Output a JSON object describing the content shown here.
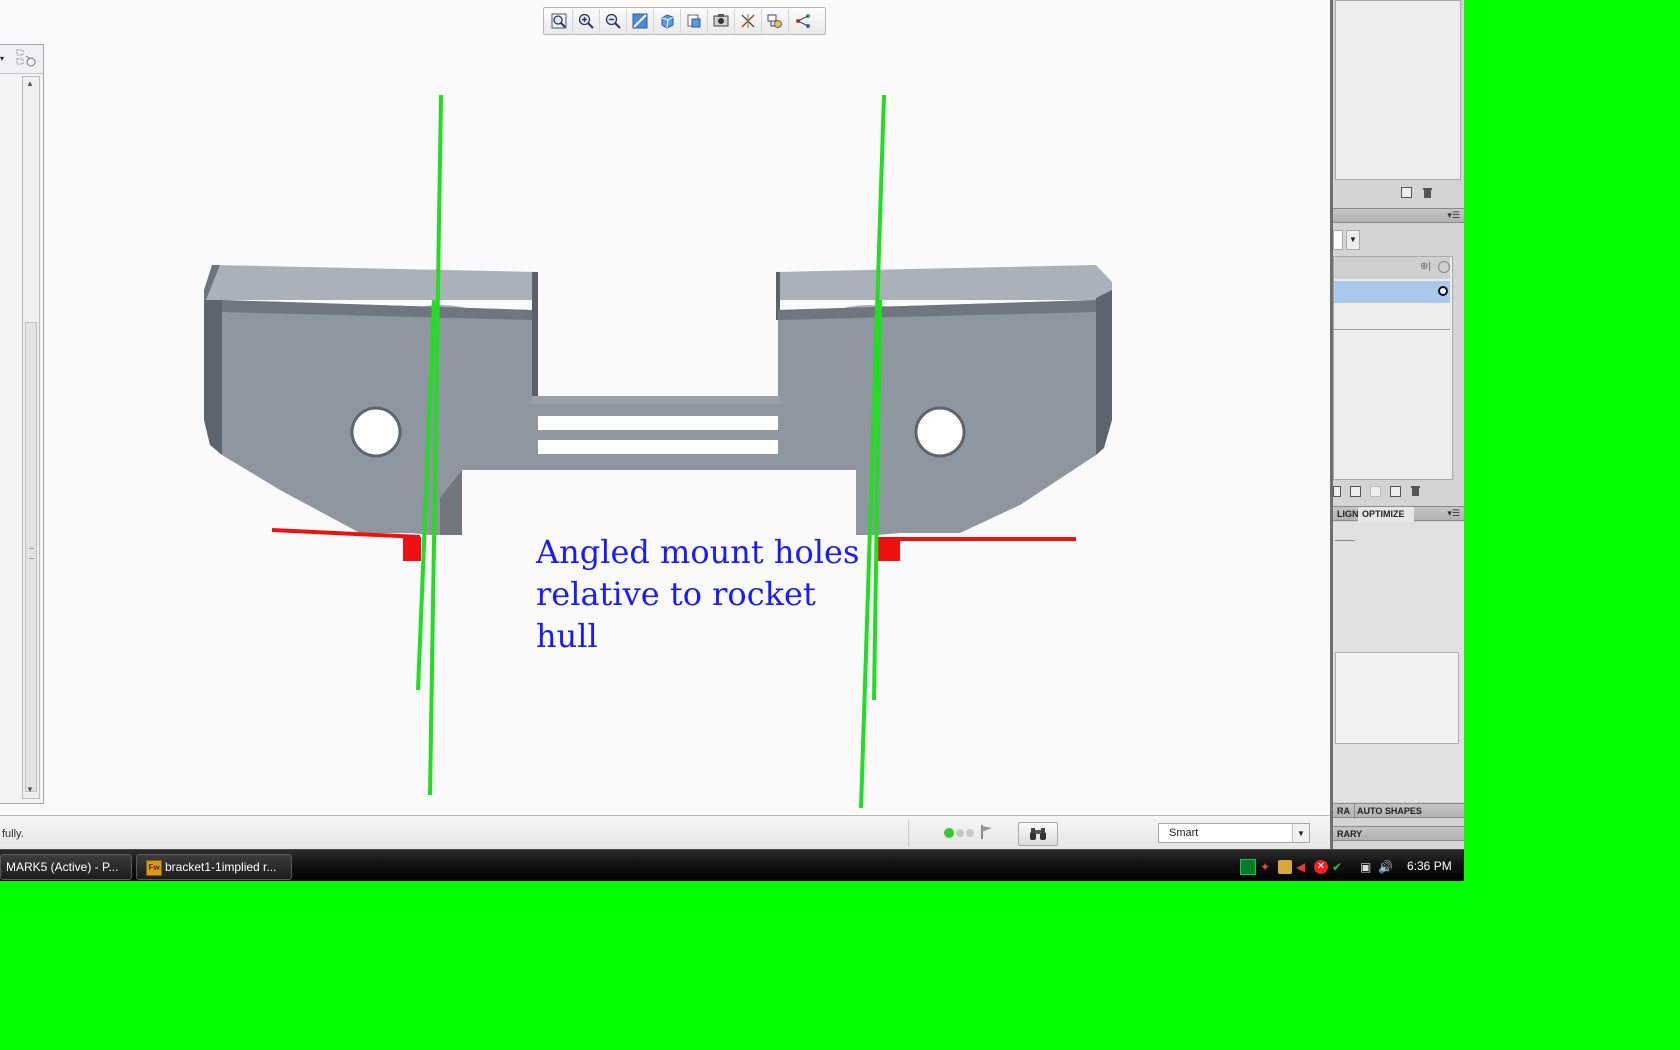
{
  "toolbar": {
    "buttons": [
      {
        "icon": "zoom-fit-icon"
      },
      {
        "icon": "zoom-in-icon"
      },
      {
        "icon": "zoom-out-icon"
      },
      {
        "icon": "repaint-icon"
      },
      {
        "icon": "view-orient-icon"
      },
      {
        "icon": "saved-views-icon"
      },
      {
        "icon": "display-style-icon"
      },
      {
        "icon": "datum-display-icon"
      },
      {
        "icon": "spin-center-icon"
      },
      {
        "icon": "annotation-display-icon"
      }
    ]
  },
  "annotation": {
    "line1": "Angled mount holes",
    "line2": "relative to rocket",
    "line3": "hull",
    "color": "#1a1aff"
  },
  "status_bar": {
    "message": "fully.",
    "select_filter": "Smart"
  },
  "right_dock": {
    "tab_align_partial": "LIGN",
    "tab_optimize": "OPTIMIZE",
    "tab_library_partial": "RA",
    "tab_auto_shapes": "AUTO SHAPES",
    "tab_library2_partial": "RARY"
  },
  "taskbar": {
    "items": [
      {
        "label": "MARK5 (Active) - P..."
      },
      {
        "label": "bracket1-1implied r..."
      }
    ],
    "clock": "6:36 PM"
  },
  "colors": {
    "background": "#00ff00",
    "model": "#8c949e",
    "guide_lines": "#22dd22",
    "hull_lines": "#ee1111"
  }
}
